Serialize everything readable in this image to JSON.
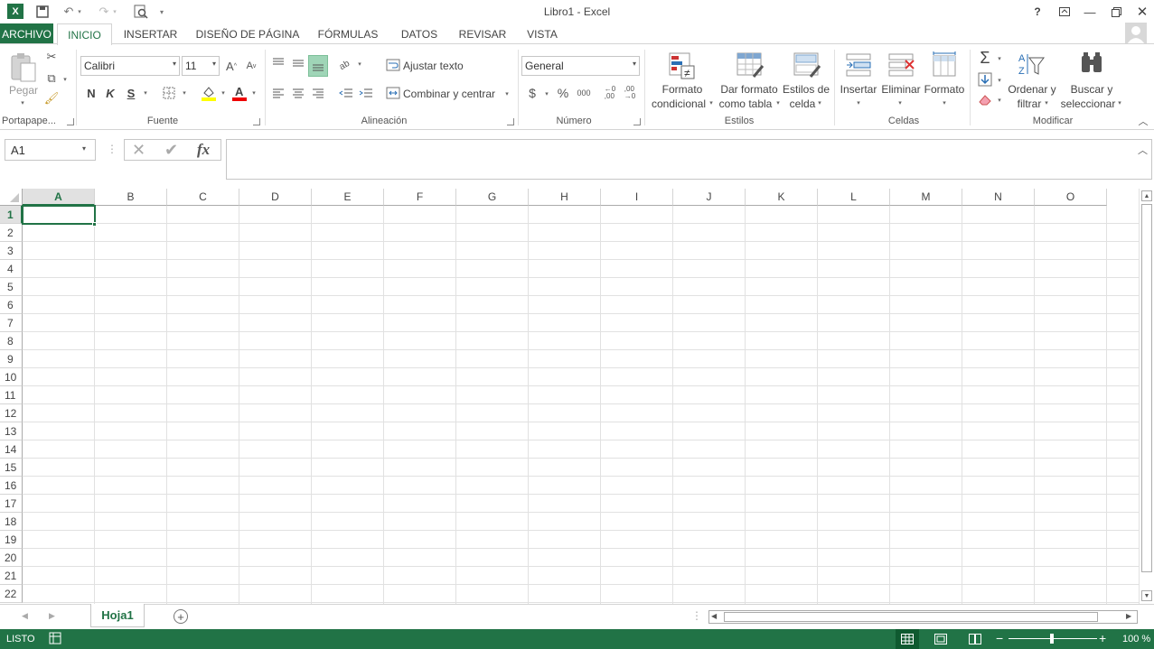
{
  "window": {
    "title": "Libro1 -  Excel",
    "help": "?"
  },
  "tabs": [
    "ARCHIVO",
    "INICIO",
    "INSERTAR",
    "DISEÑO DE PÁGINA",
    "FÓRMULAS",
    "DATOS",
    "REVISAR",
    "VISTA"
  ],
  "ribbon": {
    "clipboard": {
      "paste": "Pegar",
      "group": "Portapape..."
    },
    "font": {
      "name": "Calibri",
      "size": "11",
      "bold": "N",
      "italic": "K",
      "underline": "S",
      "group": "Fuente"
    },
    "alignment": {
      "wrap": "Ajustar texto",
      "merge": "Combinar y centrar",
      "group": "Alineación"
    },
    "number": {
      "format": "General",
      "currency": "$",
      "percent": "%",
      "thousands": "000",
      "group": "Número"
    },
    "styles": {
      "cond1": "Formato",
      "cond2": "condicional",
      "table1": "Dar formato",
      "table2": "como tabla",
      "cell1": "Estilos de",
      "cell2": "celda",
      "group": "Estilos"
    },
    "cells": {
      "insert": "Insertar",
      "delete": "Eliminar",
      "format": "Formato",
      "group": "Celdas"
    },
    "editing": {
      "sort1": "Ordenar y",
      "sort2": "filtrar",
      "find1": "Buscar y",
      "find2": "seleccionar",
      "group": "Modificar"
    }
  },
  "formula_bar": {
    "name_box": "A1",
    "fx": "fx",
    "value": ""
  },
  "columns": [
    "A",
    "B",
    "C",
    "D",
    "E",
    "F",
    "G",
    "H",
    "I",
    "J",
    "K",
    "L",
    "M",
    "N",
    "O"
  ],
  "rows": [
    "1",
    "2",
    "3",
    "4",
    "5",
    "6",
    "7",
    "8",
    "9",
    "10",
    "11",
    "12",
    "13",
    "14",
    "15",
    "16",
    "17",
    "18",
    "19",
    "20",
    "21",
    "22"
  ],
  "sheet": {
    "tab": "Hoja1"
  },
  "status": {
    "ready": "LISTO",
    "zoom": "100 %"
  },
  "colors": {
    "accent": "#217346"
  }
}
